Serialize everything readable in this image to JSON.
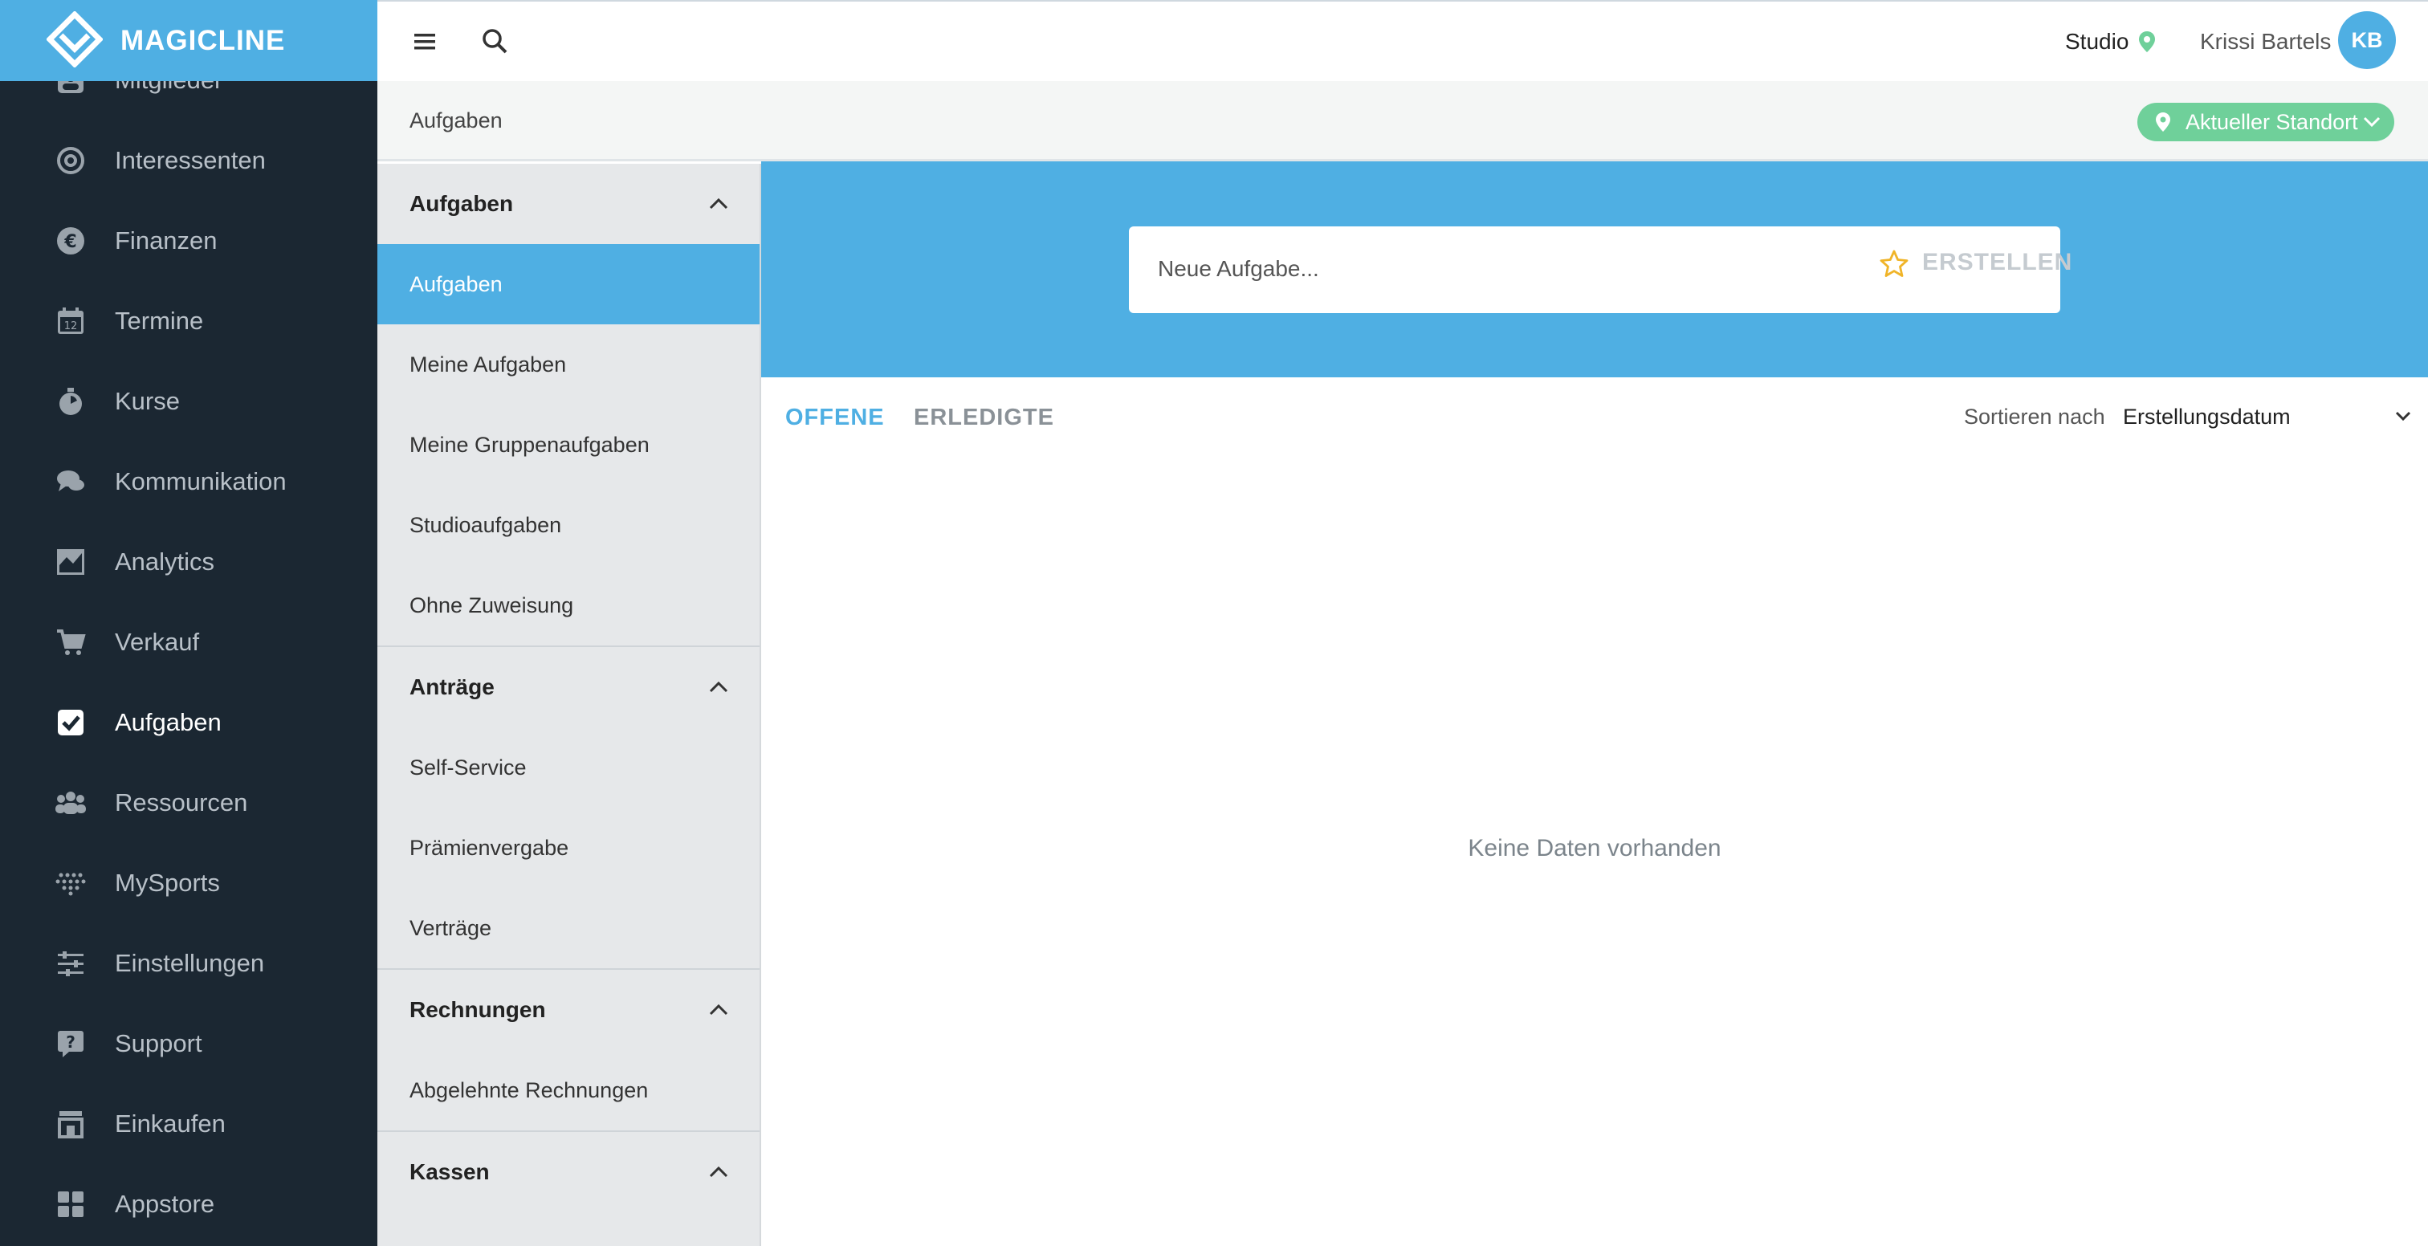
{
  "brand": {
    "name": "MAGICLINE"
  },
  "nav": {
    "items": [
      {
        "label": "Mitglieder",
        "icon": "member-icon"
      },
      {
        "label": "Interessenten",
        "icon": "target-icon"
      },
      {
        "label": "Finanzen",
        "icon": "euro-icon"
      },
      {
        "label": "Termine",
        "icon": "calendar-icon"
      },
      {
        "label": "Kurse",
        "icon": "stopwatch-icon"
      },
      {
        "label": "Kommunikation",
        "icon": "chat-icon"
      },
      {
        "label": "Analytics",
        "icon": "chart-icon"
      },
      {
        "label": "Verkauf",
        "icon": "cart-icon"
      },
      {
        "label": "Aufgaben",
        "icon": "checkbox-icon",
        "active": true
      },
      {
        "label": "Ressourcen",
        "icon": "people-icon"
      },
      {
        "label": "MySports",
        "icon": "mysports-icon"
      },
      {
        "label": "Einstellungen",
        "icon": "sliders-icon"
      },
      {
        "label": "Support",
        "icon": "help-icon"
      },
      {
        "label": "Einkaufen",
        "icon": "shop-icon"
      },
      {
        "label": "Appstore",
        "icon": "apps-icon"
      }
    ]
  },
  "header": {
    "studio": "Studio",
    "user": "Krissi Bartels",
    "initials": "KB"
  },
  "breadcrumb": {
    "current": "Aufgaben",
    "location_button": "Aktueller Standort"
  },
  "subnav": {
    "sections": [
      {
        "title": "Aufgaben",
        "items": [
          "Aufgaben",
          "Meine Aufgaben",
          "Meine Gruppenaufgaben",
          "Studioaufgaben",
          "Ohne Zuweisung"
        ]
      },
      {
        "title": "Anträge",
        "items": [
          "Self-Service",
          "Prämienvergabe",
          "Verträge"
        ]
      },
      {
        "title": "Rechnungen",
        "items": [
          "Abgelehnte Rechnungen"
        ]
      },
      {
        "title": "Kassen",
        "items": []
      }
    ]
  },
  "task": {
    "placeholder": "Neue Aufgabe...",
    "create_label": "ERSTELLEN"
  },
  "tabs": {
    "open": "OFFENE",
    "done": "ERLEDIGTE"
  },
  "sort": {
    "label": "Sortieren nach",
    "value": "Erstellungsdatum"
  },
  "empty": "Keine Daten vorhanden",
  "colors": {
    "brand": "#4fafe3",
    "nav_bg": "#1b2732",
    "location": "#6fd09a"
  }
}
